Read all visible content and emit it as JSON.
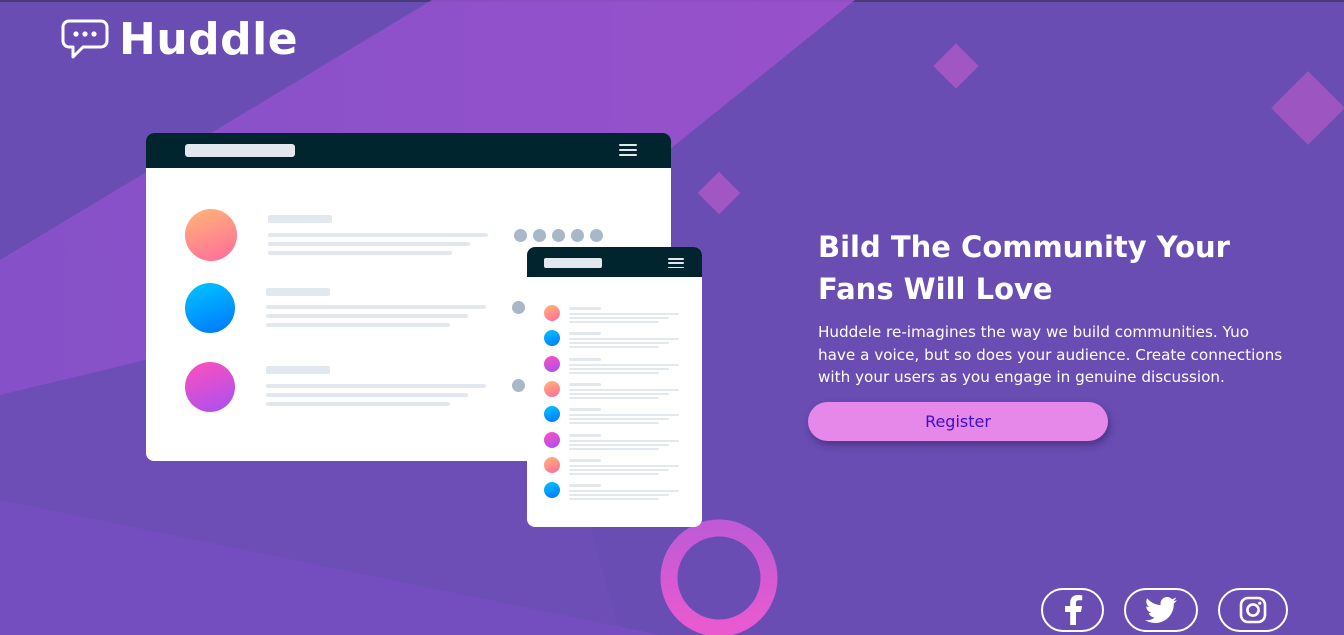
{
  "brand": {
    "name": "Huddle"
  },
  "hero": {
    "headline": "Bild The Community Your Fans Will Love",
    "description": "Huddele re-imagines the way we build communities. Yuo have a voice, but so does your audience. Create connections with your users as you engage in genuine discussion.",
    "register_label": "Register"
  },
  "social": [
    "facebook-icon",
    "twitter-icon",
    "instagram-icon"
  ],
  "colors": {
    "background": "#6a4db3",
    "accent_pink": "#e588ea",
    "button_text": "#3b0fc4",
    "mockup_bar": "#00252f"
  }
}
